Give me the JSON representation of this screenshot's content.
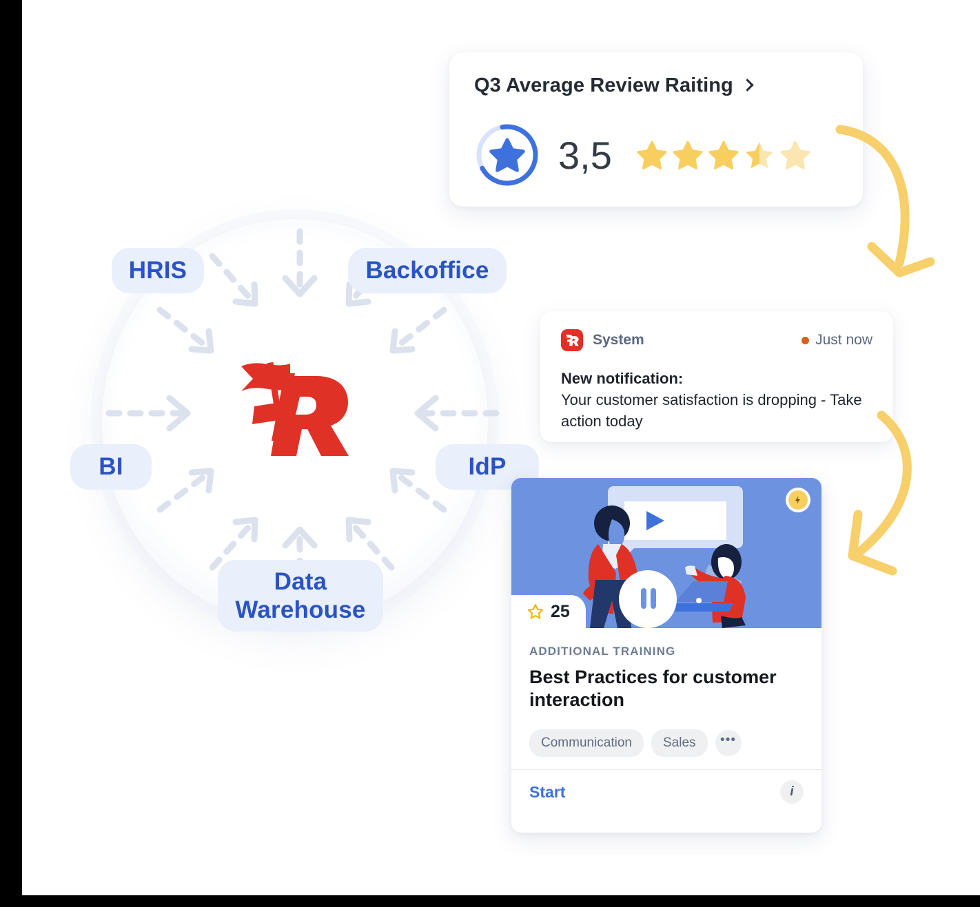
{
  "theme": {
    "brand_red": "#e03127",
    "brand_blue": "#3f71dd",
    "pill_bg": "#e9effb",
    "pill_text": "#2a53c4",
    "star_gold": "#f8cf5f",
    "star_pale": "#fbe5b0",
    "arrow_yellow": "#f7cf6b",
    "hero_blue": "#6d92e0",
    "muted_text": "#5b6880"
  },
  "edge_watermark": "",
  "hub": {
    "logo_name": "flag-r-logo",
    "nodes": [
      {
        "id": "hris",
        "label": "HRIS"
      },
      {
        "id": "backoffice",
        "label": "Backoffice"
      },
      {
        "id": "bi",
        "label": "BI"
      },
      {
        "id": "idp",
        "label": "IdP"
      },
      {
        "id": "data-warehouse",
        "label": "Data Warehouse",
        "line1": "Data",
        "line2": "Warehouse"
      }
    ],
    "arrow_count": 8
  },
  "rating_card": {
    "title": "Q3 Average Review Raiting",
    "chevron_icon": "chevron-right-icon",
    "value": "3,5",
    "ring_icon": "star-badge-icon",
    "ring_progress_percent": 70,
    "stars": [
      {
        "fill": "full"
      },
      {
        "fill": "full"
      },
      {
        "fill": "full"
      },
      {
        "fill": "half"
      },
      {
        "fill": "empty"
      }
    ],
    "stars_out_of": 5
  },
  "notification_card": {
    "app_icon": "flag-r-app-icon",
    "source": "System",
    "status_dot": "unread-dot",
    "time": "Just now",
    "heading": "New notification:",
    "message": "Your customer satisfaction is dropping - Take action today"
  },
  "training_card": {
    "hero": {
      "bolt_badge_icon": "lightning-bolt-icon",
      "play_icon": "play-icon",
      "pause_icon": "pause-icon",
      "illustration_name": "two-people-video-training-illustration"
    },
    "points_badge": {
      "icon": "star-outline-icon",
      "count": "25"
    },
    "kicker": "ADDITIONAL TRAINING",
    "title": "Best Practices for customer interaction",
    "tags": [
      "Communication",
      "Sales"
    ],
    "tags_more_icon": "ellipsis-icon",
    "footer": {
      "start_label": "Start",
      "info_icon": "info-icon"
    }
  },
  "flow_arrows": [
    {
      "id": "arrow-rating-to-notification",
      "icon": "curved-arrow-down-icon"
    },
    {
      "id": "arrow-notification-to-training",
      "icon": "curved-arrow-down-left-icon"
    }
  ]
}
